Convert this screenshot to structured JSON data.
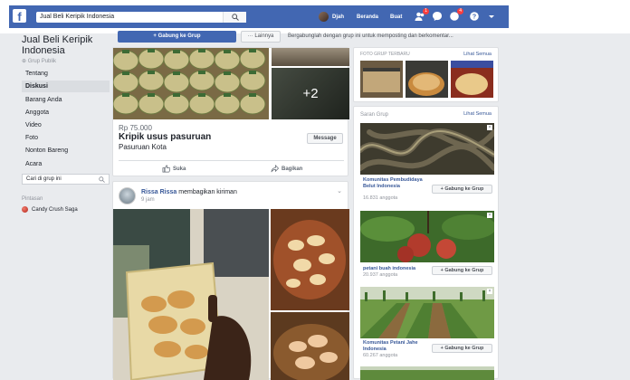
{
  "topbar": {
    "search_value": "Jual Beli Keripik Indonesia",
    "user_name": "Djah",
    "nav_home": "Beranda",
    "nav_create": "Buat",
    "friend_badge": "1",
    "notif_badge": "4"
  },
  "sidebar": {
    "group_name": "Jual Beli Keripik Indonesia",
    "privacy": "Grup Publik",
    "items": [
      {
        "label": "Tentang"
      },
      {
        "label": "Diskusi"
      },
      {
        "label": "Barang Anda"
      },
      {
        "label": "Anggota"
      },
      {
        "label": "Video"
      },
      {
        "label": "Foto"
      },
      {
        "label": "Nonton Bareng"
      },
      {
        "label": "Acara"
      }
    ],
    "active_index": 1,
    "search_placeholder": "Cari di grup ini",
    "shortcuts_heading": "Pintasan",
    "shortcut_label": "Candy Crush Saga"
  },
  "group_bar": {
    "join_label": "+ Gabung ke Grup",
    "more_label": "··· Lainnya",
    "join_prompt": "Bergabunglah dengan grup ini untuk memposting dan berkomentar..."
  },
  "post1": {
    "more_photos": "+2",
    "price": "Rp 75.000",
    "title": "Kripik usus pasuruan",
    "location": "Pasuruan Kota",
    "message_label": "Message",
    "like_label": "Suka",
    "share_label": "Bagikan"
  },
  "post2": {
    "author": "Rissa Rissa",
    "action_text": "membagikan kiriman",
    "time": "9 jam"
  },
  "recent_photos": {
    "heading": "Foto grup terbaru",
    "see_all": "Lihat Semua"
  },
  "suggested_groups": {
    "heading": "Saran Grup",
    "see_all": "Lihat Semua",
    "join_label": "+ Gabung ke Grup",
    "items": [
      {
        "name": "Komunitas Pembudidaya Belut Indonesia",
        "members": "16.831 anggota"
      },
      {
        "name": "petani buah indonesia",
        "members": "20.937 anggota"
      },
      {
        "name": "Komunitas Petani Jahe Indonesia",
        "members": "60.267 anggota"
      }
    ]
  }
}
